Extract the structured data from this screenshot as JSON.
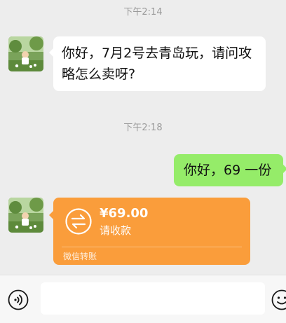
{
  "chat": {
    "time1": "下午2:14",
    "msg1": "你好，7月2号去青岛玩，请问攻略怎么卖呀?",
    "time2": "下午2:18",
    "msg2": "你好，69 一份",
    "transfer": {
      "amount": "¥69.00",
      "status": "请收款",
      "footer": "微信转账"
    }
  },
  "icons": {
    "voice": "voice-icon",
    "emoji": "emoji-icon",
    "transfer": "transfer-arrows-icon"
  },
  "colors": {
    "background": "#ededed",
    "incoming": "#ffffff",
    "outgoing": "#95ec69",
    "transfer": "#fa9d3b"
  }
}
